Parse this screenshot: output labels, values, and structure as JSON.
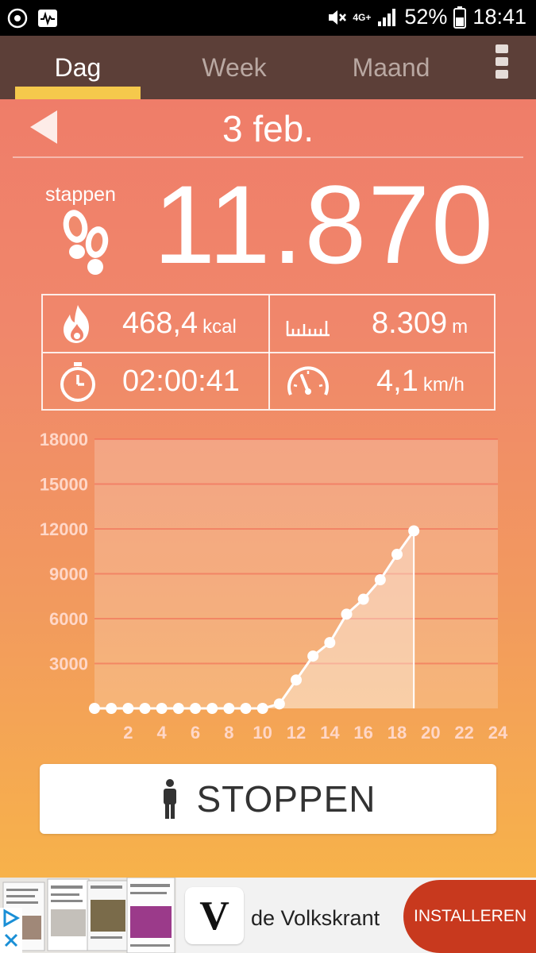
{
  "status_bar": {
    "battery": "52%",
    "time": "18:41",
    "network": "4G+",
    "icons": [
      "sync-icon",
      "activity-icon",
      "mute-icon",
      "signal-icon",
      "battery-icon"
    ]
  },
  "tabs": [
    {
      "label": "Dag",
      "active": true
    },
    {
      "label": "Week",
      "active": false
    },
    {
      "label": "Maand",
      "active": false
    }
  ],
  "date": "3 feb.",
  "steps": {
    "label": "stappen",
    "value": "11.870"
  },
  "stats": {
    "calories": {
      "value": "468,4",
      "unit": "kcal"
    },
    "distance": {
      "value": "8.309",
      "unit": "m"
    },
    "duration": {
      "value": "02:00:41",
      "unit": ""
    },
    "speed": {
      "value": "4,1",
      "unit": "km/h"
    }
  },
  "chart_data": {
    "type": "area",
    "x_ticks": [
      2,
      4,
      6,
      8,
      10,
      12,
      14,
      16,
      18,
      20,
      22,
      24
    ],
    "y_ticks": [
      3000,
      6000,
      9000,
      12000,
      15000,
      18000
    ],
    "ylim": [
      0,
      18000
    ],
    "xlim": [
      0,
      24
    ],
    "x": [
      0,
      1,
      2,
      3,
      4,
      5,
      6,
      7,
      8,
      9,
      10,
      11,
      12,
      13,
      14,
      15,
      16,
      17,
      18,
      19
    ],
    "values": [
      0,
      0,
      0,
      0,
      0,
      0,
      0,
      0,
      0,
      0,
      0,
      300,
      1900,
      3500,
      4400,
      6300,
      7300,
      8600,
      10300,
      11870
    ],
    "grid": true,
    "colors": {
      "line": "#ffffff",
      "area": "rgba(255,255,255,0.35)",
      "plot_bg": "rgba(255,255,255,0.2)",
      "grid": "rgba(240,100,80,0.55)",
      "tick_labels": "#ffd7c8"
    }
  },
  "stop_button": {
    "label": "STOPPEN"
  },
  "ad": {
    "app_name": "de Volkskrant",
    "logo_letter": "V",
    "install_label": "INSTALLEREN"
  },
  "colors": {
    "tab_bar": "#5c3f38",
    "tab_underline": "#f5c94c",
    "install": "#c8391e"
  }
}
